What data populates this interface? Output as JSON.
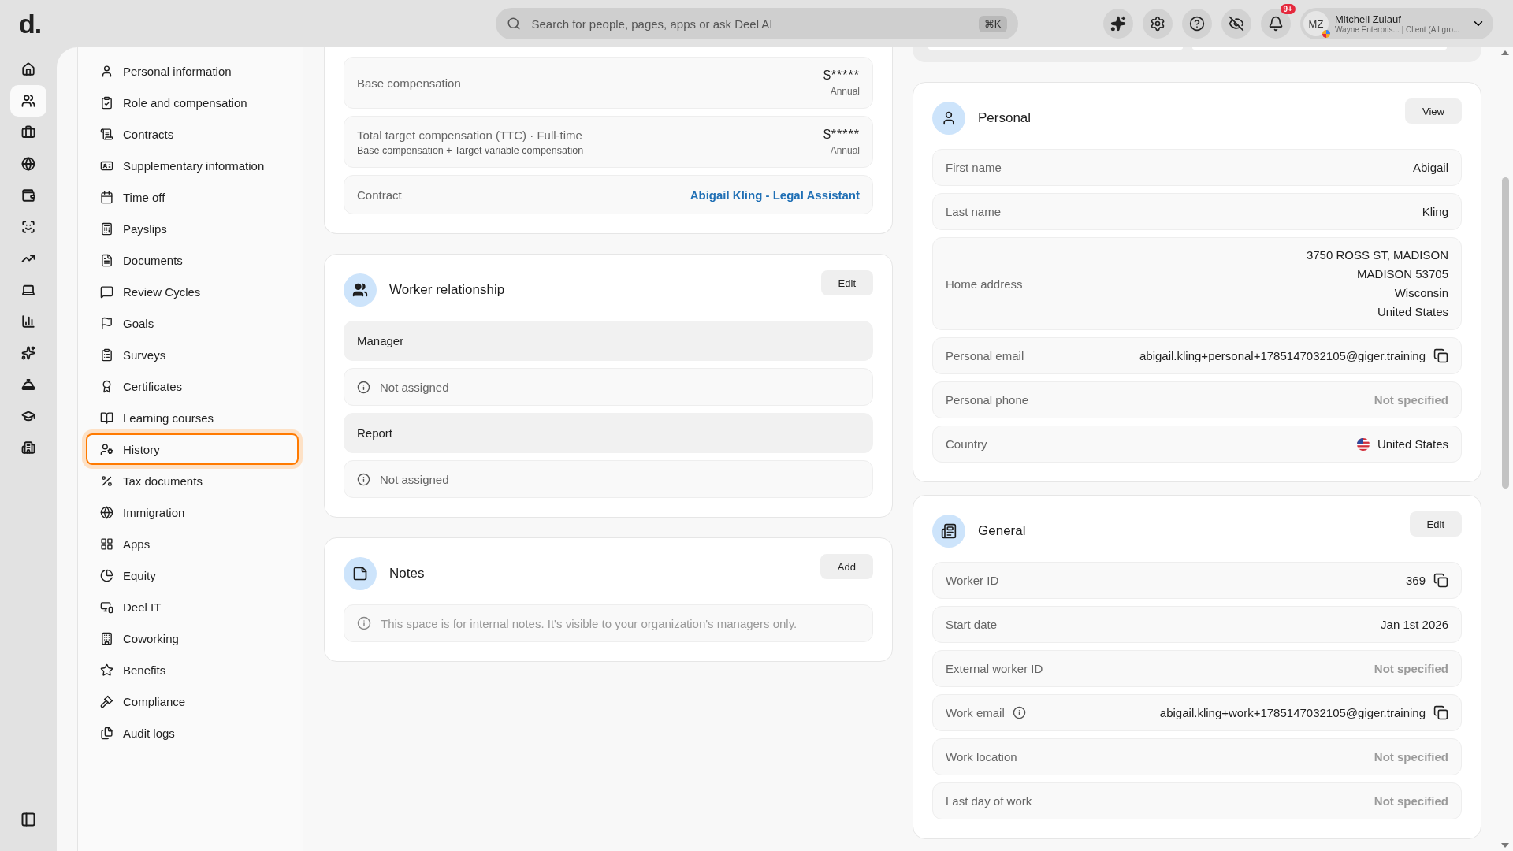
{
  "top_bar": {
    "logo": "d.",
    "search": {
      "placeholder": "Search for people, pages, apps or ask Deel AI",
      "shortcut": "⌘K"
    },
    "notifications_badge": "9+",
    "user": {
      "initials": "MZ",
      "name": "Mitchell Zulauf",
      "subtitle": "Wayne Enterpris... | Client (All gro..."
    }
  },
  "rail": [
    {
      "selected": false
    },
    {
      "selected": true
    },
    {
      "selected": false
    },
    {
      "selected": false
    },
    {
      "selected": false
    },
    {
      "selected": false
    },
    {
      "selected": false
    },
    {
      "selected": false
    },
    {
      "selected": false
    },
    {
      "selected": false
    },
    {
      "selected": false
    },
    {
      "selected": false
    },
    {
      "selected": false
    }
  ],
  "sidebar": {
    "items": [
      {
        "label": "Personal information",
        "selected": false
      },
      {
        "label": "Role and compensation",
        "selected": false
      },
      {
        "label": "Contracts",
        "selected": false
      },
      {
        "label": "Supplementary information",
        "selected": false
      },
      {
        "label": "Time off",
        "selected": false
      },
      {
        "label": "Payslips",
        "selected": false
      },
      {
        "label": "Documents",
        "selected": false
      },
      {
        "label": "Review Cycles",
        "selected": false
      },
      {
        "label": "Goals",
        "selected": false
      },
      {
        "label": "Surveys",
        "selected": false
      },
      {
        "label": "Certificates",
        "selected": false
      },
      {
        "label": "Learning courses",
        "selected": false
      },
      {
        "label": "History",
        "selected": true
      },
      {
        "label": "Tax documents",
        "selected": false
      },
      {
        "label": "Immigration",
        "selected": false
      },
      {
        "label": "Apps",
        "selected": false
      },
      {
        "label": "Equity",
        "selected": false
      },
      {
        "label": "Deel IT",
        "selected": false
      },
      {
        "label": "Coworking",
        "selected": false
      },
      {
        "label": "Benefits",
        "selected": false
      },
      {
        "label": "Compliance",
        "selected": false
      },
      {
        "label": "Audit logs",
        "selected": false
      }
    ]
  },
  "compensation": {
    "rows": [
      {
        "kind": "amount",
        "label": "Base compensation",
        "value": "$*****",
        "period": "Annual"
      },
      {
        "kind": "amount",
        "label": "Total target compensation (TTC) · Full-time",
        "note": "Base compensation + Target variable compensation",
        "value": "$*****",
        "period": "Annual"
      },
      {
        "kind": "link",
        "label": "Contract",
        "value": "Abigail Kling - Legal Assistant"
      }
    ]
  },
  "worker_relationship": {
    "title": "Worker relationship",
    "button": "Edit",
    "items": [
      {
        "kind": "heading",
        "text": "Manager"
      },
      {
        "kind": "empty",
        "text": "Not assigned"
      },
      {
        "kind": "heading",
        "text": "Report"
      },
      {
        "kind": "empty",
        "text": "Not assigned"
      }
    ]
  },
  "notes": {
    "title": "Notes",
    "button": "Add",
    "hint": "This space is for internal notes. It's visible to your organization's managers only."
  },
  "personal": {
    "title": "Personal",
    "button": "View",
    "rows": [
      {
        "kind": "plain",
        "label": "First name",
        "value": "Abigail"
      },
      {
        "kind": "plain",
        "label": "Last name",
        "value": "Kling"
      },
      {
        "kind": "address",
        "label": "Home address",
        "lines": [
          "3750 ROSS ST, MADISON",
          "MADISON 53705",
          "Wisconsin",
          "United States"
        ]
      },
      {
        "kind": "copy",
        "label": "Personal email",
        "value": "abigail.kling+personal+1785147032105@giger.training"
      },
      {
        "kind": "missing",
        "label": "Personal phone",
        "value": "Not specified"
      },
      {
        "kind": "country",
        "label": "Country",
        "value": "United States"
      }
    ]
  },
  "general": {
    "title": "General",
    "button": "Edit",
    "rows": [
      {
        "kind": "copy",
        "label": "Worker ID",
        "value": "369"
      },
      {
        "kind": "plain",
        "label": "Start date",
        "value": "Jan 1st 2026"
      },
      {
        "kind": "missing",
        "label": "External worker ID",
        "value": "Not specified"
      },
      {
        "kind": "copy",
        "label": "Work email",
        "info": true,
        "value": "abigail.kling+work+1785147032105@giger.training"
      },
      {
        "kind": "missing",
        "label": "Work location",
        "value": "Not specified"
      },
      {
        "kind": "missing",
        "label": "Last day of work",
        "value": "Not specified"
      }
    ]
  }
}
